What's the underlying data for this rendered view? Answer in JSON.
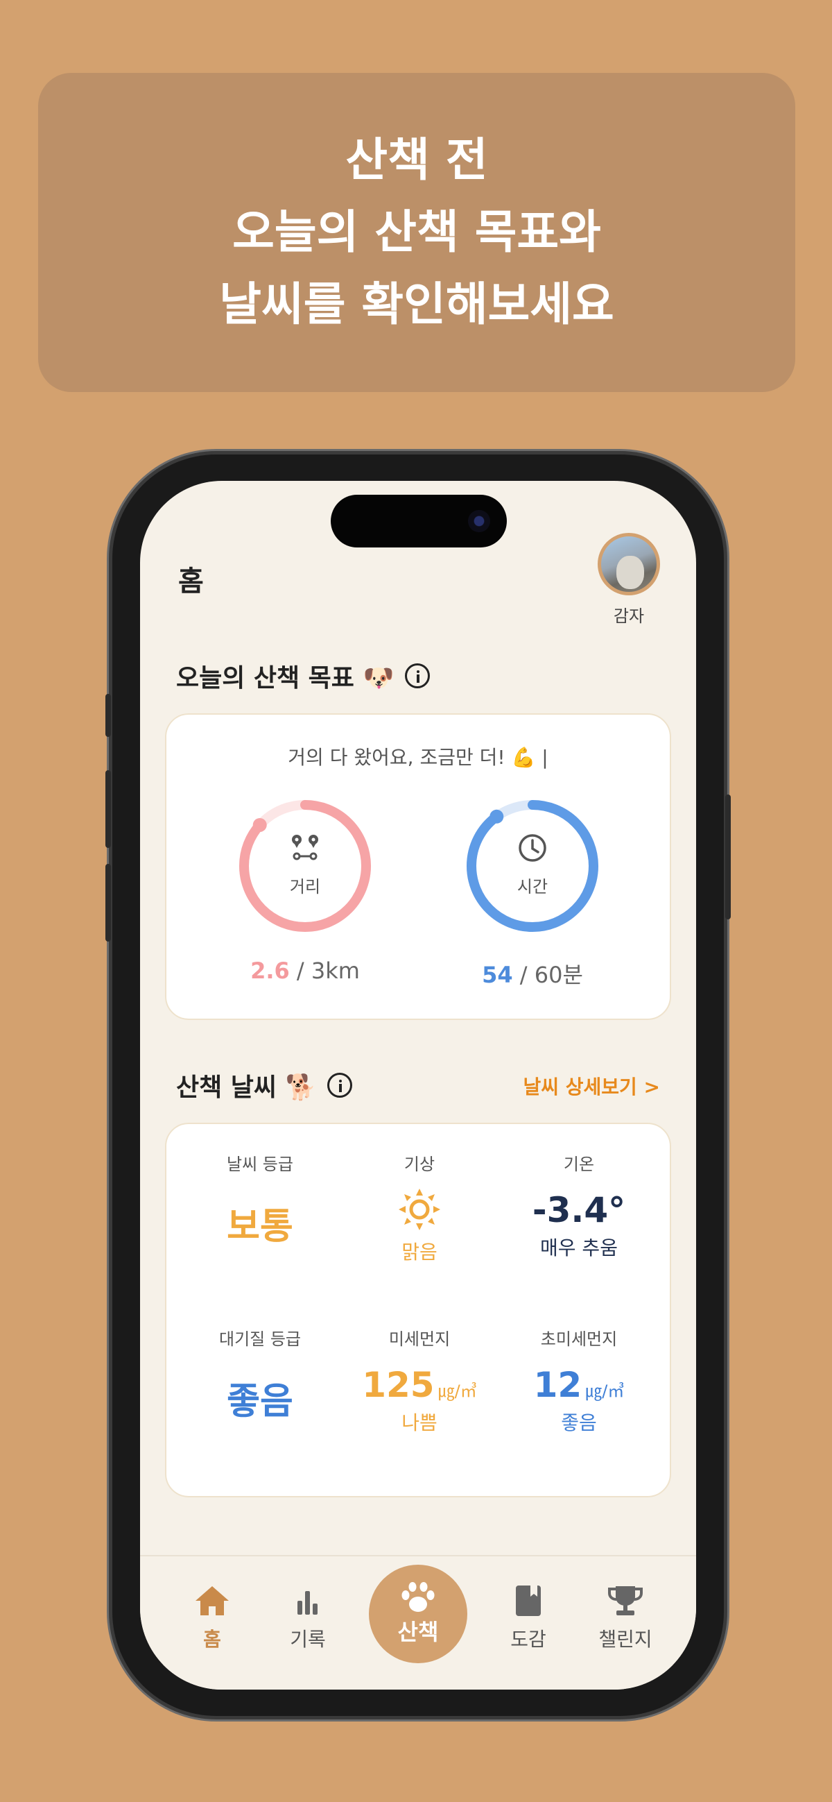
{
  "banner": {
    "line1": "산책 전",
    "line2": "오늘의 산책 목표와",
    "line3": "날씨를 확인해보세요"
  },
  "header": {
    "title": "홈",
    "profile_name": "감자"
  },
  "goal": {
    "section_title": "오늘의 산책 목표 🐶",
    "message": "거의 다 왔어요, 조금만 더! 💪 |",
    "distance": {
      "label": "거리",
      "current": "2.6",
      "target": "3km",
      "separator": "/",
      "progress": 0.867,
      "color": "#F6A4A6",
      "track_color": "#FCE6E6"
    },
    "time": {
      "label": "시간",
      "current": "54",
      "target": "60분",
      "separator": "/",
      "progress": 0.9,
      "color": "#5E9BE6",
      "track_color": "#DCE8F8"
    }
  },
  "weather": {
    "section_title": "산책 날씨 🐕",
    "detail_link": "날씨 상세보기 >",
    "grade": {
      "label": "날씨 등급",
      "value": "보통",
      "color": "#F0A93E"
    },
    "condition": {
      "label": "기상",
      "icon": "sun-icon",
      "value": "맑음",
      "color": "#F0A93E"
    },
    "temperature": {
      "label": "기온",
      "value": "-3.4°",
      "desc": "매우 추움",
      "color": "#1F2F4F"
    },
    "air_grade": {
      "label": "대기질 등급",
      "value": "좋음",
      "color": "#3F7FD6"
    },
    "pm10": {
      "label": "미세먼지",
      "value": "125",
      "unit": "㎍/㎥",
      "desc": "나쁨",
      "color": "#F0A93E"
    },
    "pm25": {
      "label": "초미세먼지",
      "value": "12",
      "unit": "㎍/㎥",
      "desc": "좋음",
      "color": "#3F7FD6"
    }
  },
  "tabbar": {
    "home": "홈",
    "records": "기록",
    "walk": "산책",
    "dex": "도감",
    "challenge": "챌린지",
    "active_color": "#C98A4A"
  }
}
